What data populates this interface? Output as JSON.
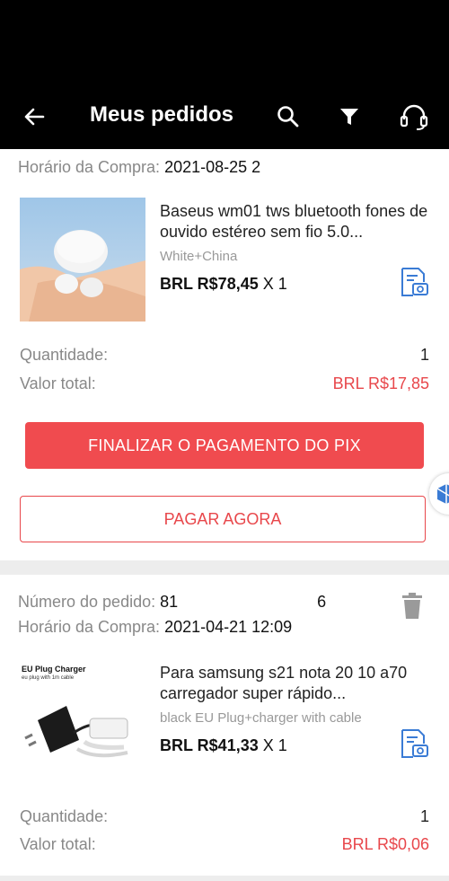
{
  "header": {
    "title": "Meus pedidos"
  },
  "labels": {
    "purchase_time": "Horário da Compra:",
    "order_number": "Número do pedido:",
    "quantity": "Quantidade:",
    "total": "Valor total:"
  },
  "orders": [
    {
      "purchase_time": "2021-08-25 2",
      "product_name": "Baseus wm01 tws bluetooth fones de ouvido estéreo sem fio 5.0...",
      "variant": "White+China",
      "price": "BRL R$78,45",
      "qty_suffix": "X 1",
      "quantity": "1",
      "total": "BRL R$17,85",
      "primary_button": "FINALIZAR O PAGAMENTO DO PIX",
      "secondary_button": "PAGAR AGORA"
    },
    {
      "order_number_start": "81",
      "order_number_end": "6",
      "purchase_time": "2021-04-21 12:09",
      "thumb_caption_title": "EU Plug Charger",
      "thumb_caption_sub": "eu plug with 1m cable",
      "product_name": "Para samsung s21 nota 20 10 a70 carregador super rápido...",
      "variant": "black EU Plug+charger with cable",
      "price": "BRL R$41,33",
      "qty_suffix": "X 1",
      "quantity": "1",
      "total": "BRL R$0,06"
    }
  ],
  "colors": {
    "accent": "#f04b4f",
    "price_red": "#e8474b",
    "icon_blue": "#3a7bd5"
  }
}
